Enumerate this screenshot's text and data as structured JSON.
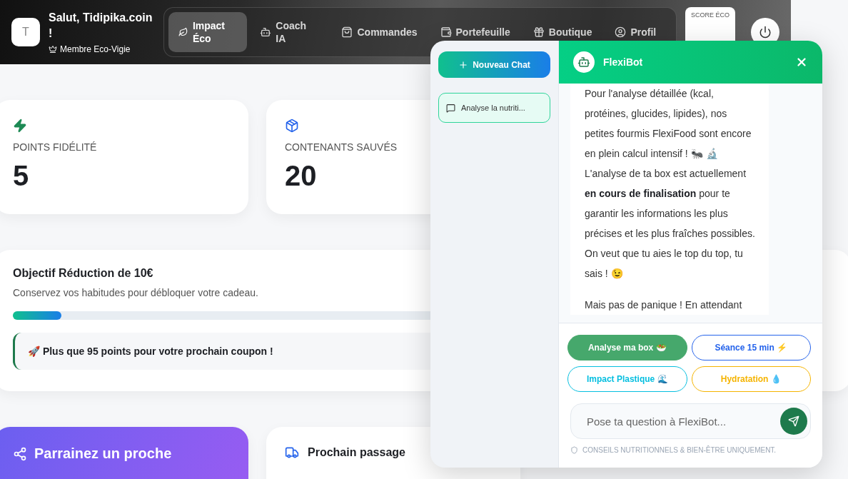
{
  "header": {
    "avatar_initial": "T",
    "greeting": "Salut, Tidipika.coin !",
    "badge": "Membre Eco-Vigie",
    "score_label": "SCORE ÉCO"
  },
  "nav": [
    {
      "label": "Impact Éco",
      "kind": "leaf",
      "selected": true
    },
    {
      "label": "Coach IA",
      "kind": "bot",
      "selected": false
    },
    {
      "label": "Commandes",
      "kind": "bag",
      "selected": false
    },
    {
      "label": "Portefeuille",
      "kind": "wallet",
      "selected": false
    },
    {
      "label": "Boutique",
      "kind": "gift",
      "selected": false
    },
    {
      "label": "Profil",
      "kind": "user",
      "selected": false
    }
  ],
  "stats": [
    {
      "label": "POINTS FIDÉLITÉ",
      "value": "5",
      "kind": "bolt"
    },
    {
      "label": "CONTENANTS SAUVÉS",
      "value": "20",
      "kind": "box"
    }
  ],
  "goal": {
    "title": "Objectif Réduction de 10€",
    "subtitle": "Conservez vos habitudes pour débloquer votre cadeau.",
    "level": 0.1,
    "note": "🚀 Plus que 95 points pour votre prochain coupon !"
  },
  "referral": {
    "title": "Parrainez un proche"
  },
  "next_pickup": {
    "title": "Prochain passage"
  },
  "chat": {
    "new_chat": "Nouveau Chat",
    "history": [
      {
        "title": "Analyse la nutriti...",
        "selected": true
      }
    ],
    "bot_name": "FlexiBot",
    "messages": [
      "Pour l'analyse détaillée (kcal, protéines, glucides, lipides), nos petites fourmis FlexiFood sont encore en plein calcul intensif ! 🐜 🔬 L'analyse de ta box est actuellement **en cours de finalisation** pour te garantir les informations les plus précises et les plus fraîches possibles. On veut que tu aies le top du top, tu sais ! 😉",
      "Mais pas de panique ! En attendant"
    ],
    "suggestions": [
      {
        "label": "Analyse ma box 🥗",
        "color": "#46a86c",
        "selected": true
      },
      {
        "label": "Séance 15 min ⚡",
        "color": "#2563eb",
        "selected": false
      },
      {
        "label": "Impact Plastique 🌊",
        "color": "#06bfe0",
        "selected": false
      },
      {
        "label": "Hydratation 💧",
        "color": "#f5b400",
        "selected": false
      }
    ],
    "placeholder": "Pose ta question à FlexiBot...",
    "disclaimer": "CONSEILS NUTRITIONNELS & BIEN-ÊTRE UNIQUEMENT."
  }
}
